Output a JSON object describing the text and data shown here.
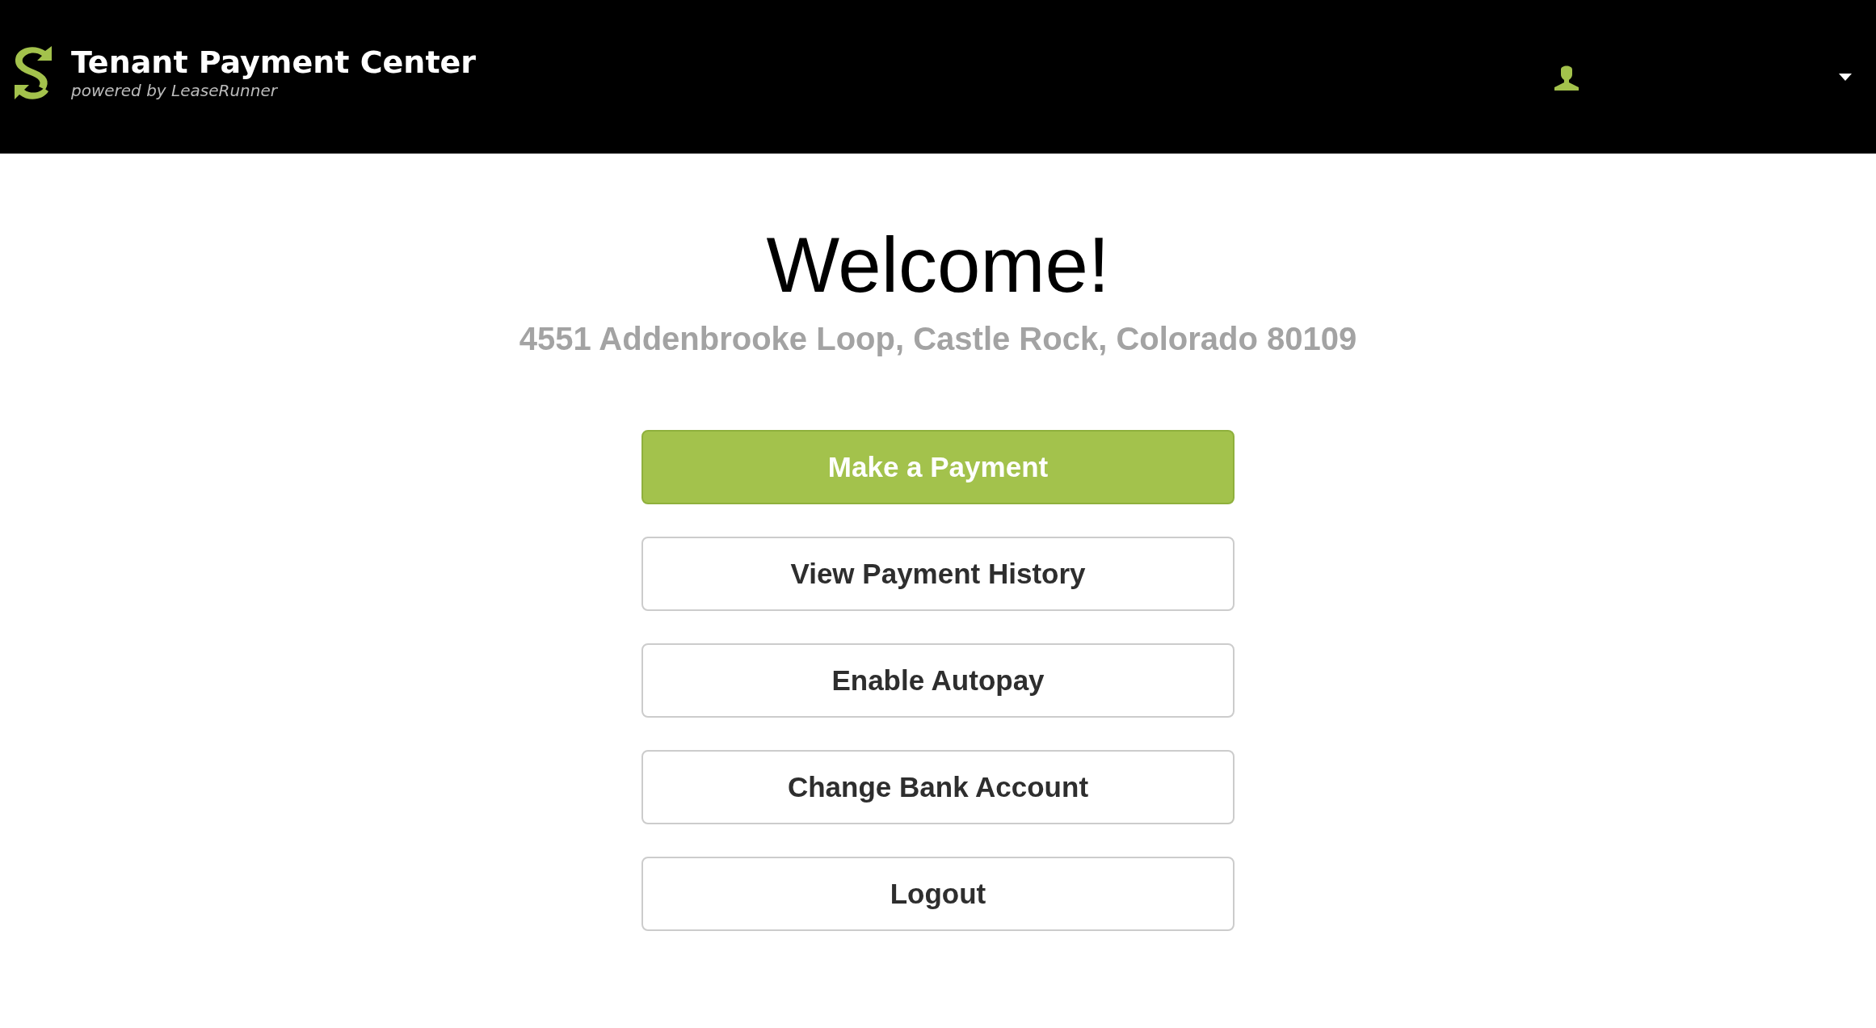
{
  "header": {
    "title": "Tenant Payment Center",
    "subtitle": "powered by LeaseRunner"
  },
  "welcome": {
    "heading": "Welcome!",
    "address": "4551 Addenbrooke Loop, Castle Rock, Colorado 80109"
  },
  "buttons": [
    {
      "label": "Make a Payment",
      "kind": "primary"
    },
    {
      "label": "View Payment History",
      "kind": "default"
    },
    {
      "label": "Enable Autopay",
      "kind": "default"
    },
    {
      "label": "Change Bank Account",
      "kind": "default"
    },
    {
      "label": "Logout",
      "kind": "default"
    }
  ]
}
